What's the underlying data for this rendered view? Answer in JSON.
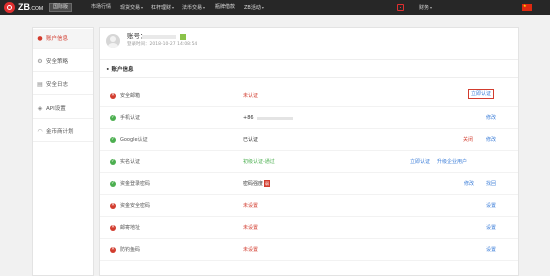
{
  "header": {
    "logo_text": "ZB",
    "logo_suffix": ".COM",
    "switch_label": "国际版",
    "nav": [
      {
        "label": "市场行情",
        "has_caret": false
      },
      {
        "label": "现货交易",
        "has_caret": true
      },
      {
        "label": "杠杆理财",
        "has_caret": true
      },
      {
        "label": "法币交易",
        "has_caret": true
      },
      {
        "label": "瓶牌借款",
        "has_caret": false
      },
      {
        "label": "ZB活动",
        "has_caret": true
      }
    ],
    "finance_label": "财务"
  },
  "sidebar": {
    "items": [
      {
        "label": "账户信息",
        "icon": "user-icon",
        "active": true
      },
      {
        "label": "安全策略",
        "icon": "gear-icon",
        "active": false
      },
      {
        "label": "安全日志",
        "icon": "log-icon",
        "active": false
      },
      {
        "label": "API设置",
        "icon": "api-icon",
        "active": false
      },
      {
        "label": "金币商计划",
        "icon": "wifi-icon",
        "active": false
      }
    ]
  },
  "profile": {
    "account_label": "账号：",
    "login_time": "登录时间：2018-10-27 14:08:54"
  },
  "section": {
    "title": "账户信息"
  },
  "rows": [
    {
      "label": "安全邮箱",
      "status": "bad",
      "value": "未认证",
      "value_color": "red",
      "actions": [
        "立即认证"
      ]
    },
    {
      "label": "手机认证",
      "status": "ok",
      "value": "+86",
      "value_color": "dark",
      "actions": [
        "修改"
      ]
    },
    {
      "label": "Google认证",
      "status": "ok",
      "value": "已认证",
      "value_color": "dark",
      "actions": [
        "关闭",
        "修改"
      ]
    },
    {
      "label": "实名认证",
      "status": "ok",
      "value": "初级认证-通过",
      "value_color": "green",
      "actions": [
        "立即认证",
        "升级企业用户"
      ]
    },
    {
      "label": "资金登录密码",
      "status": "ok",
      "value": "密码强度",
      "value_color": "dark",
      "badge": "弱",
      "actions": [
        "修改",
        "找回"
      ]
    },
    {
      "label": "资金安全密码",
      "status": "bad",
      "value": "未设置",
      "value_color": "red",
      "actions": [
        "设置"
      ]
    },
    {
      "label": "邮寄地址",
      "status": "bad",
      "value": "未设置",
      "value_color": "red",
      "actions": [
        "设置"
      ]
    },
    {
      "label": "防钓鱼码",
      "status": "bad",
      "value": "未设置",
      "value_color": "red",
      "actions": [
        "设置"
      ]
    }
  ],
  "colors": {
    "accent": "#d23c2e",
    "link": "#3b7dd8",
    "ok": "#4caf50",
    "topbar": "#272727"
  }
}
